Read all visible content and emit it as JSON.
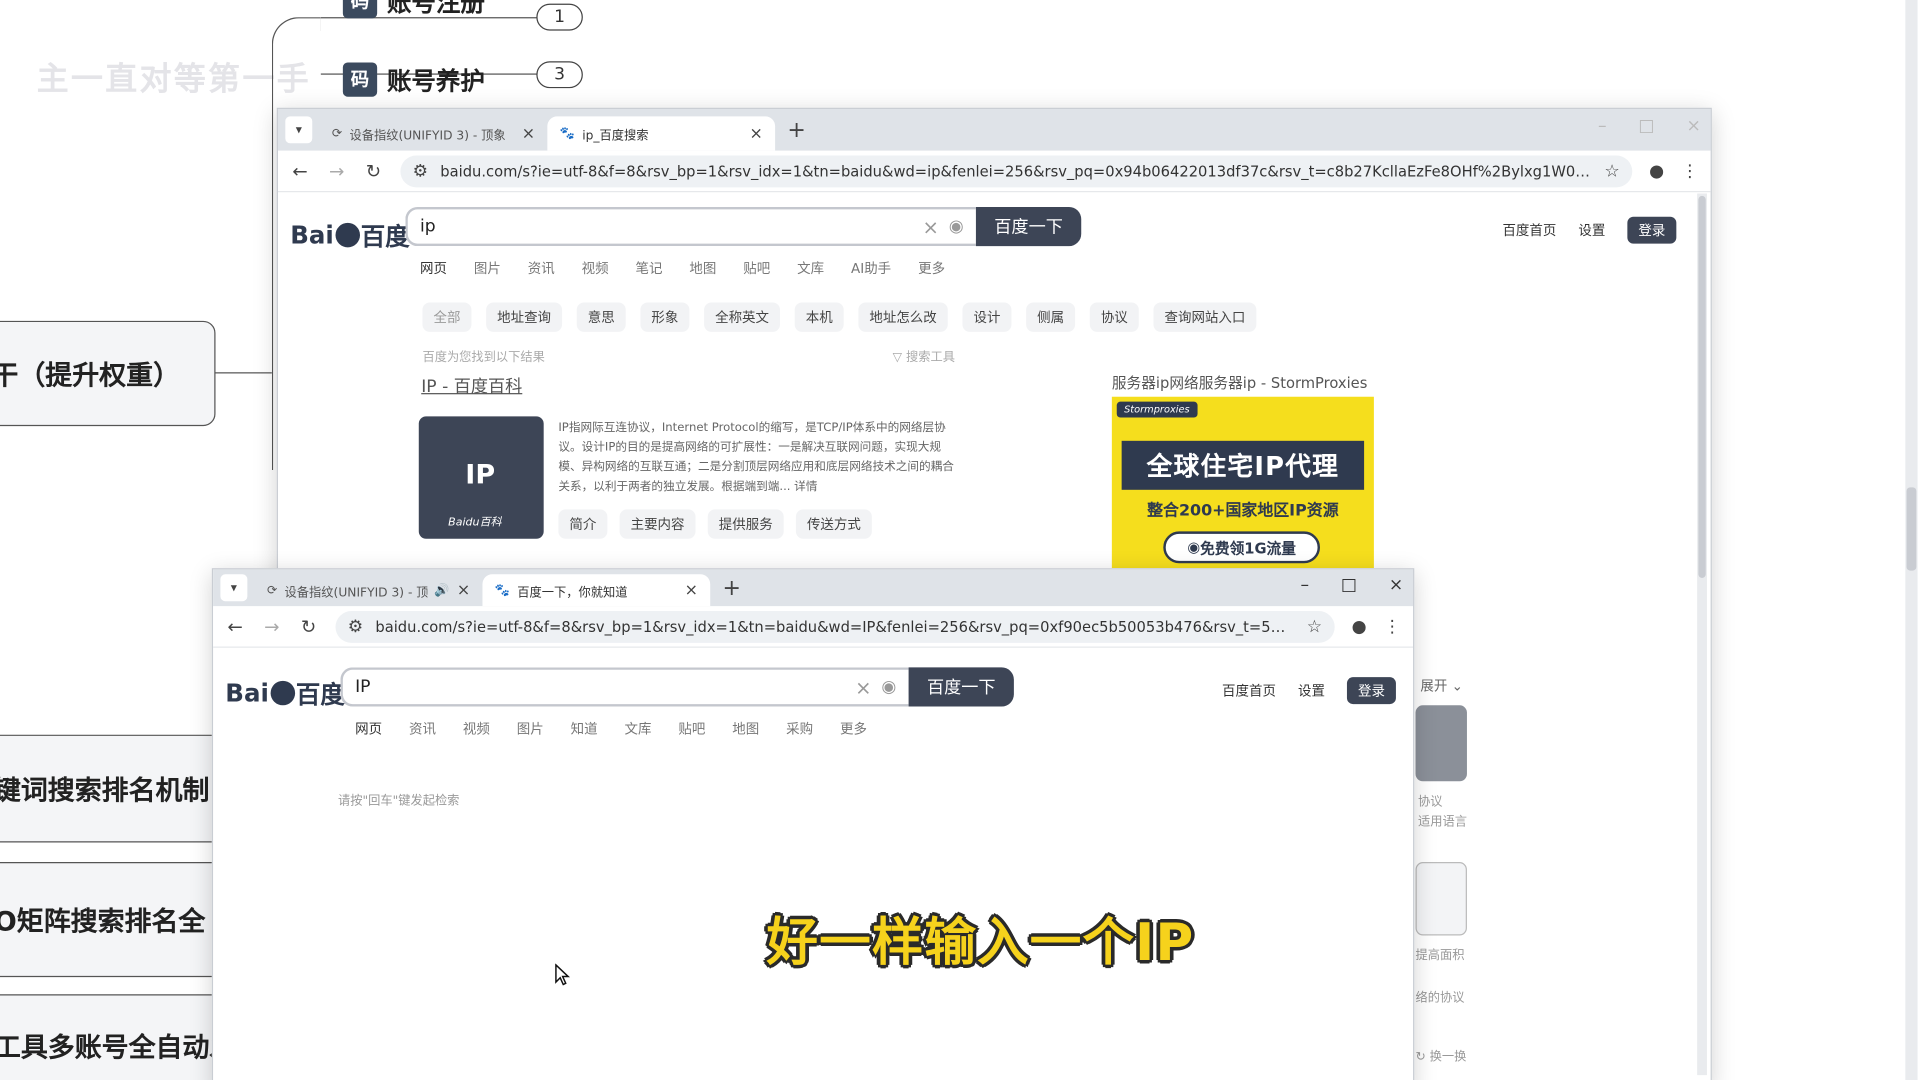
{
  "mindmap": {
    "top_label": "账号注册",
    "top_badge": "1",
    "second_label": "账号养护",
    "second_badge": "3",
    "icon_glyph": "码",
    "ghost_text": "主一直对等第一手",
    "left_nodes": [
      {
        "label": "干（提升权重）"
      },
      {
        "label": "键词搜索排名机制"
      },
      {
        "label": "O矩阵搜索排名全"
      },
      {
        "label": "工具多账号全自动发布"
      }
    ]
  },
  "browser_back": {
    "tabs": [
      {
        "title": "设备指纹(UNIFYID 3) - 顶象",
        "active": false
      },
      {
        "title": "ip_百度搜索",
        "active": true
      }
    ],
    "url": "baidu.com/s?ie=utf-8&f=8&rsv_bp=1&rsv_idx=1&tn=baidu&wd=ip&fenlei=256&rsv_pq=0x94b06422013df37c&rsv_t=c8b27KcllaEzFe8OHf%2Bylxg1W0hd1oglzHA92xsNlGohd...",
    "search_value": "ip",
    "search_button": "百度一下",
    "header_links": [
      "百度首页",
      "设置"
    ],
    "login": "登录",
    "nav_tabs": [
      "网页",
      "图片",
      "资讯",
      "视频",
      "笔记",
      "地图",
      "贴吧",
      "文库",
      "AI助手",
      "更多"
    ],
    "filters": [
      "全部",
      "地址查询",
      "意思",
      "形象",
      "全称英文",
      "本机",
      "地址怎么改",
      "设计",
      "侧属",
      "协议",
      "查询网站入口"
    ],
    "result_note": "百度为您找到以下结果",
    "search_tools": "搜索工具",
    "result_title": "IP - 百度百科",
    "wiki_text": "IP指网际互连协议，Internet Protocol的缩写，是TCP/IP体系中的网络层协议。设计IP的目的是提高网络的可扩展性：一是解决互联网问题，实现大规模、异构网络的互联互通；二是分割顶层网络应用和底层网络技术之间的耦合关系，以利于两者的独立发展。根据端到端... 详情",
    "wiki_card_caption": "Baidu百科",
    "wiki_chips": [
      "简介",
      "主要内容",
      "提供服务",
      "传送方式"
    ],
    "ad_title": "服务器ip网络服务器ip - StormProxies",
    "ad_brand": "Stormproxies",
    "ad_headline": "全球住宅IP代理",
    "ad_sub": "整合200+国家地区IP资源",
    "ad_button": "免费领1G流量",
    "right_residual": [
      "展开",
      "协议",
      "适用语言",
      "提高面积",
      "络的协议",
      "换一换"
    ]
  },
  "browser_front": {
    "tabs": [
      {
        "title": "设备指纹(UNIFYID 3) - 顶象",
        "active": false
      },
      {
        "title": "百度一下，你就知道",
        "active": true
      }
    ],
    "url": "baidu.com/s?ie=utf-8&f=8&rsv_bp=1&rsv_idx=1&tn=baidu&wd=IP&fenlei=256&rsv_pq=0xf90ec5b50053b476&rsv_t=577dlADtBpnvd9xu...",
    "search_value": "IP",
    "search_button": "百度一下",
    "header_links": [
      "百度首页",
      "设置"
    ],
    "login": "登录",
    "nav_tabs": [
      "网页",
      "资讯",
      "视频",
      "图片",
      "知道",
      "文库",
      "贴吧",
      "地图",
      "采购",
      "更多"
    ],
    "empty_hint": "请按\"回车\"键发起检索"
  },
  "subtitle": "好一样输入一个IP"
}
